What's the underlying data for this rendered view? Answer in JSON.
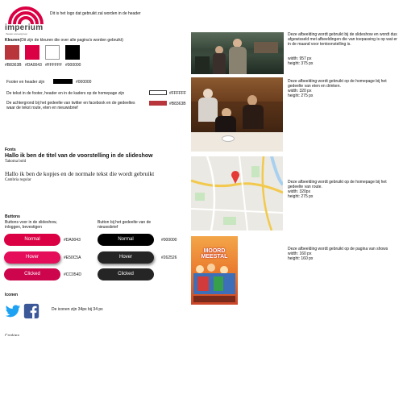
{
  "logo": {
    "name": "imperium",
    "tagline": "theater+toneelgroep",
    "note": "Dit is het logo dat gebruikt zal worden in de header"
  },
  "colors": {
    "heading": "Kleuren",
    "heading_note": "(Dit zijn de kleuren die over alle pagina's worden gebruikt)",
    "swatches": [
      {
        "hex": "#B8363B",
        "label": "#B8363B"
      },
      {
        "hex": "#DA0043",
        "label": "#DA0043"
      },
      {
        "hex": "#FFFFFF",
        "label": "#FFFFFF"
      },
      {
        "hex": "#000000",
        "label": "#000000"
      }
    ],
    "notes": [
      {
        "text": "Footer en header zijn",
        "bar": "#000000",
        "hex": "#000000"
      },
      {
        "text": "De tekst in de footer, header en in de kaders op de homepage zijn",
        "bar": "#FFFFFF",
        "hex": "#FFFFFF"
      },
      {
        "text": "De achtergrond bij het gedeelte van twitter en facebook en de gedeeltes waar de tekst route, eten en nieuwsbrief",
        "bar": "#B8363B",
        "hex": "#B8363B"
      }
    ]
  },
  "fonts": {
    "heading": "Fonts",
    "slideshow_title": "Hallo ik ben de titel van de voorstelling in de slideshow",
    "slideshow_font": "Tahoma bold",
    "body_sample": "Hallo ik ben de kopjes en de normale tekst die wordt gebruikt",
    "body_font": "Cambria regular"
  },
  "buttons": {
    "heading": "Buttons",
    "left_caption": "Buttons voor in de slideshow, inloggen, bevestigen",
    "right_caption": "Button bij het gedeelte van de nieuwsbrief",
    "left": [
      {
        "label": "Normal",
        "color": "#DA0043",
        "hex": "#DA0043"
      },
      {
        "label": "Hover",
        "color": "#E50C5A",
        "hex": "#E50C5A"
      },
      {
        "label": "Clicked",
        "color": "#CC054D",
        "hex": "#CC054D"
      }
    ],
    "right": [
      {
        "label": "Normal",
        "color": "#000000",
        "hex": "#000000"
      },
      {
        "label": "Hover",
        "color": "#262526",
        "hex": "#262526"
      },
      {
        "label": "Clicked",
        "color": "#262526",
        "hex": ""
      }
    ]
  },
  "icons": {
    "heading": "Iconen",
    "note": "De iconen zijn 34px bij 34 px",
    "items": [
      "twitter-icon",
      "facebook-icon"
    ]
  },
  "bottom_fragment": "Cookies",
  "images": [
    {
      "desc": "Deze afbeelding wordt gebruikt bij de slideshow en wordt dus afgewisseld met afbeeldingen die van toepassing is op wat er in de maand voor tentoonstelling is.",
      "width": "width: 957 px",
      "height": "height: 375 px"
    },
    {
      "desc": "Deze afbeelding wordt gebruikt op de homepage bij het gedeelte van eten en drinken.",
      "width": "width: 320 px",
      "height": "height: 275 px"
    },
    {
      "desc": "Deze afbeelding wordt gebruikt op de homepage bij het gedeelte van route.",
      "width": "width: 320px",
      "height": "height: 275 px"
    },
    {
      "desc": "Deze afbeelding wordt gebruikt op de pagina van shows",
      "width": "width: 160 px",
      "height": "height: 160 px"
    }
  ],
  "poster": {
    "title": "MOORD MEESTAL"
  }
}
